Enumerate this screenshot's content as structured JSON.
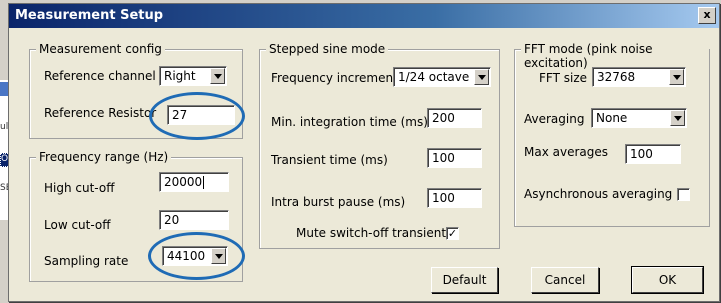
{
  "dialog": {
    "title": "Measurement Setup",
    "close_label": "x"
  },
  "background_window": {
    "row1": "",
    "row2": "ulti",
    "row3": "O C",
    "row4": "SB a"
  },
  "measurement_config": {
    "legend": "Measurement config",
    "reference_channel_label": "Reference channel",
    "reference_channel_value": "Right",
    "reference_resistor_label": "Reference Resistor",
    "reference_resistor_value": "27"
  },
  "frequency_range": {
    "legend": "Frequency range (Hz)",
    "high_cutoff_label": "High cut-off",
    "high_cutoff_value": "20000",
    "low_cutoff_label": "Low cut-off",
    "low_cutoff_value": "20",
    "sampling_rate_label": "Sampling rate",
    "sampling_rate_value": "44100"
  },
  "stepped_sine": {
    "legend": "Stepped sine mode",
    "freq_increment_label": "Frequency increment",
    "freq_increment_value": "1/24 octave",
    "min_integration_label": "Min. integration time (ms)",
    "min_integration_value": "200",
    "transient_label": "Transient time (ms)",
    "transient_value": "100",
    "intra_burst_label": "Intra burst pause (ms)",
    "intra_burst_value": "100",
    "mute_label": "Mute switch-off transients",
    "mute_checked": "✓"
  },
  "fft_mode": {
    "legend": "FFT mode (pink noise excitation)",
    "fft_size_label": "FFT size",
    "fft_size_value": "32768",
    "averaging_label": "Averaging",
    "averaging_value": "None",
    "max_averages_label": "Max averages",
    "max_averages_value": "100",
    "async_label": "Asynchronous averaging",
    "async_checked": ""
  },
  "buttons": {
    "default": "Default",
    "cancel": "Cancel",
    "ok": "OK"
  },
  "colors": {
    "annotation_oval": "#1f6bb5",
    "titlebar_start": "#0a246a",
    "titlebar_end": "#a6caf0"
  }
}
